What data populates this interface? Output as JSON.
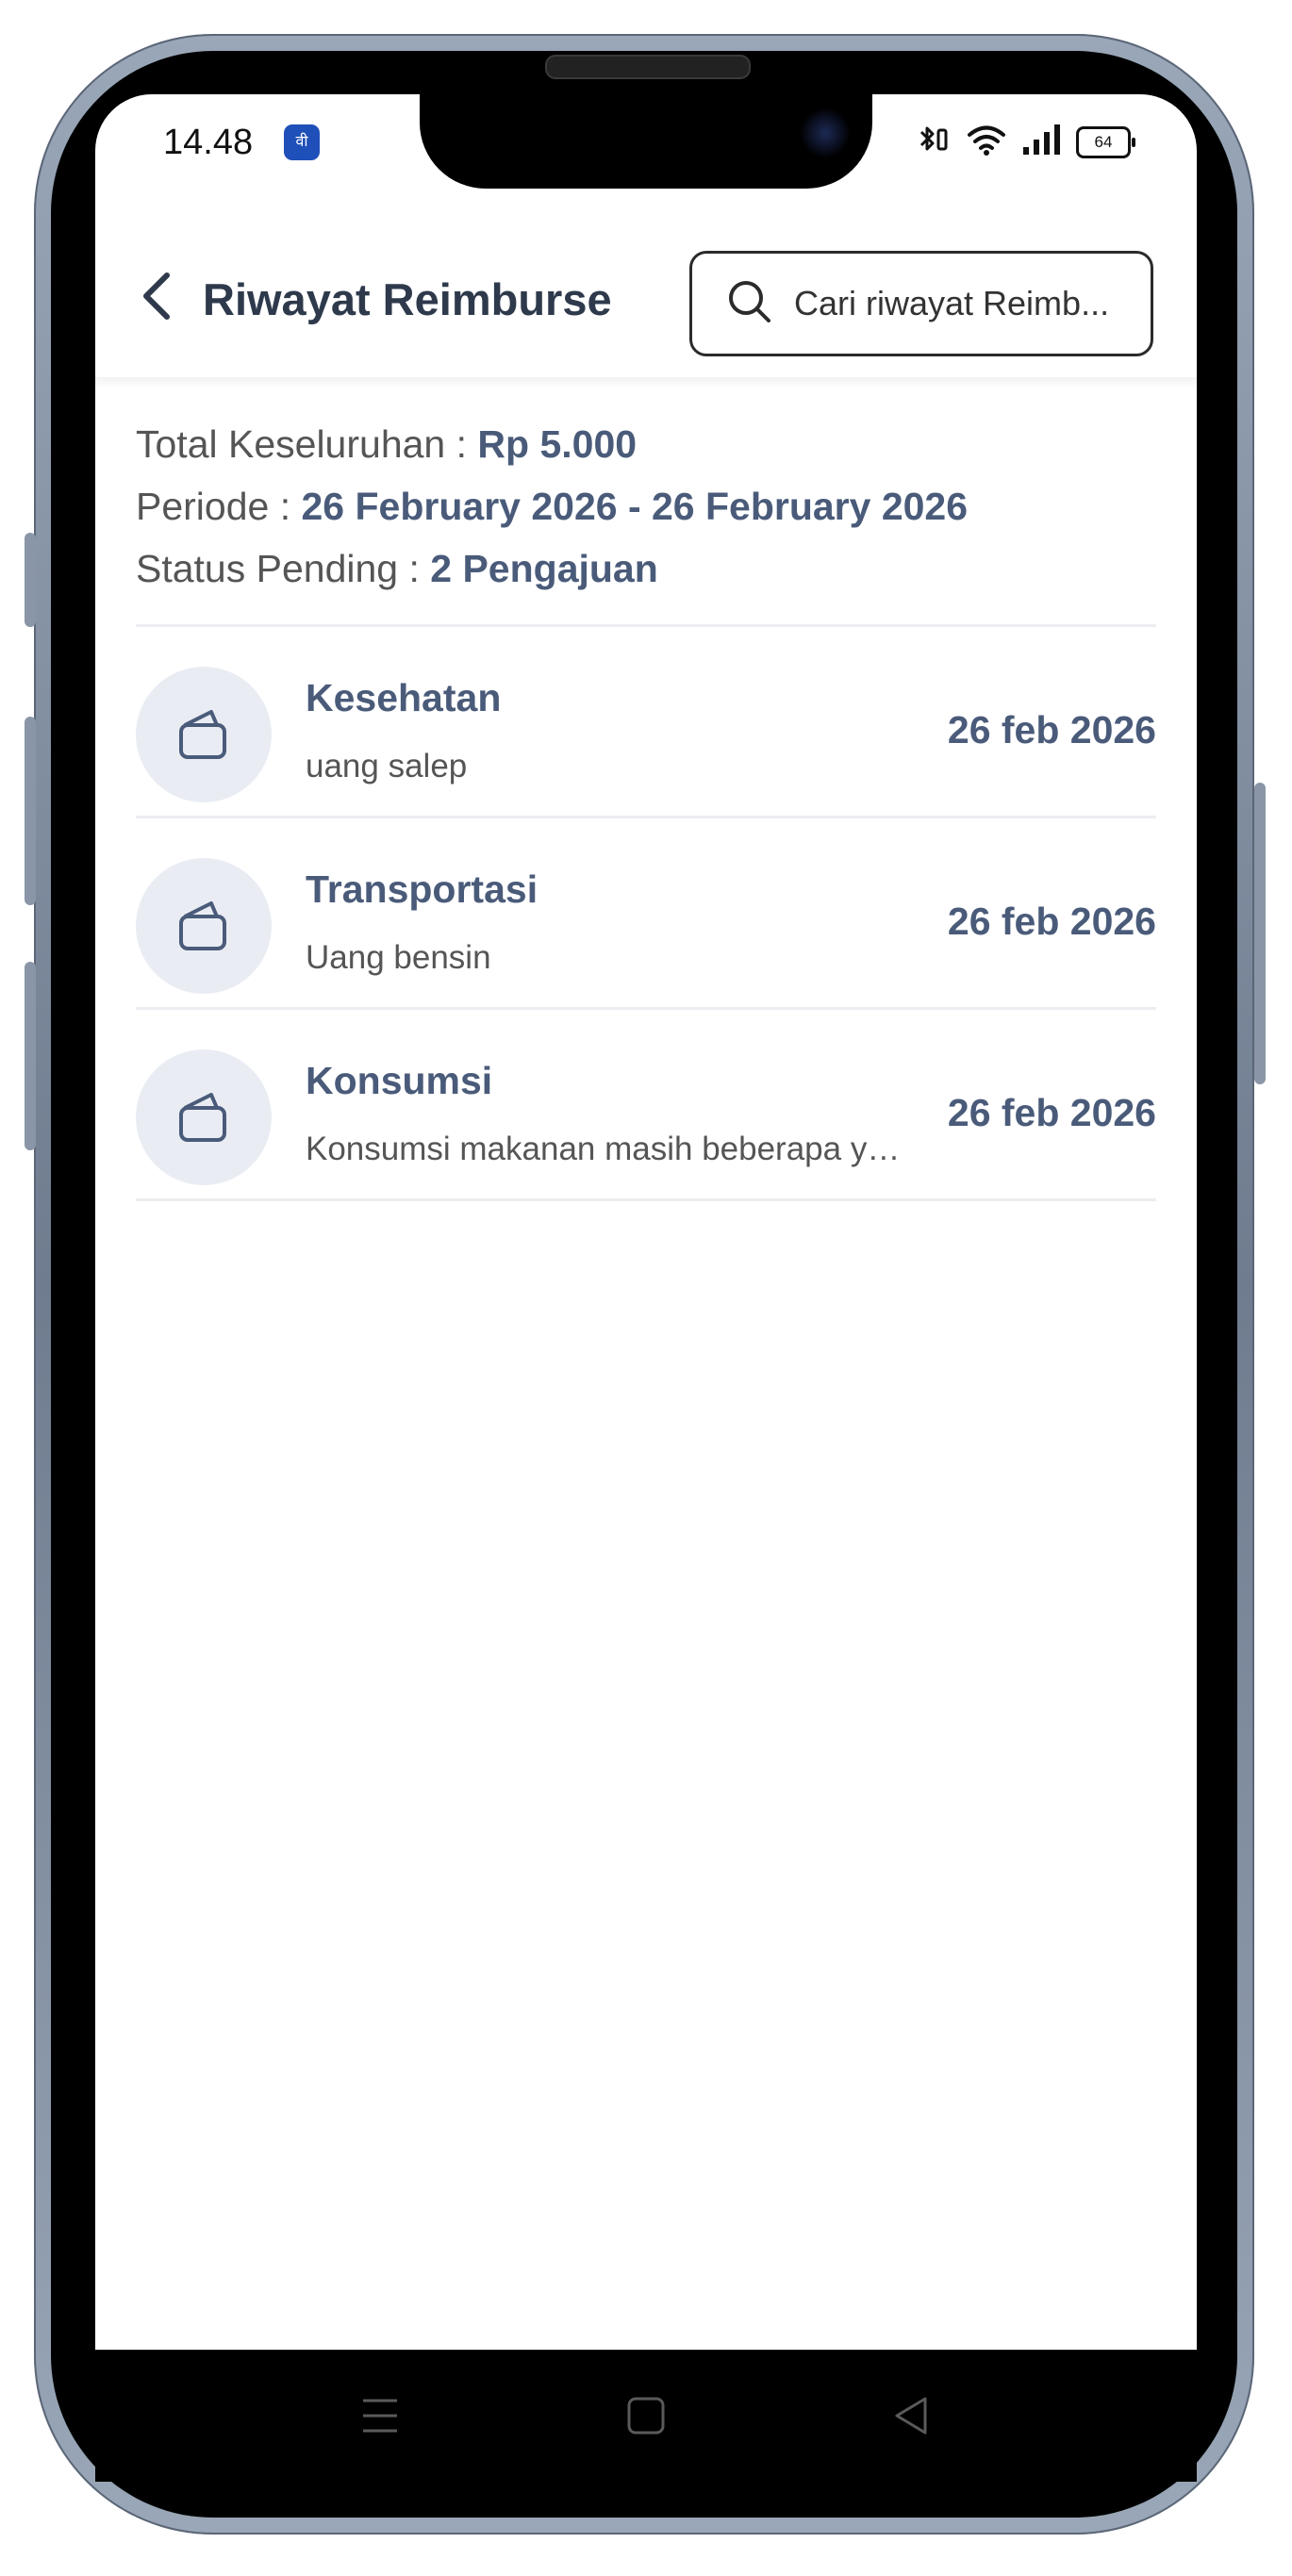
{
  "status_bar": {
    "time": "14.48",
    "app_badge": "वी",
    "battery": "64"
  },
  "header": {
    "title": "Riwayat Reimburse",
    "search_placeholder": "Cari riwayat Reimb..."
  },
  "summary": {
    "total_label": "Total Keseluruhan : ",
    "total_value": "Rp 5.000",
    "period_label": "Periode : ",
    "period_value": "26 February 2026 - 26 February 2026",
    "pending_label": "Status Pending : ",
    "pending_value": "2 Pengajuan"
  },
  "items": [
    {
      "title": "Kesehatan",
      "desc": "uang salep",
      "date": "26 feb 2026"
    },
    {
      "title": "Transportasi",
      "desc": "Uang bensin",
      "date": "26 feb 2026"
    },
    {
      "title": "Konsumsi",
      "desc": "Konsumsi makanan masih beberapa y…",
      "date": "26 feb 2026"
    }
  ],
  "colors": {
    "accent": "#4a5b7a",
    "title": "#2e3a4c",
    "icon_bg": "#e9edf3"
  }
}
